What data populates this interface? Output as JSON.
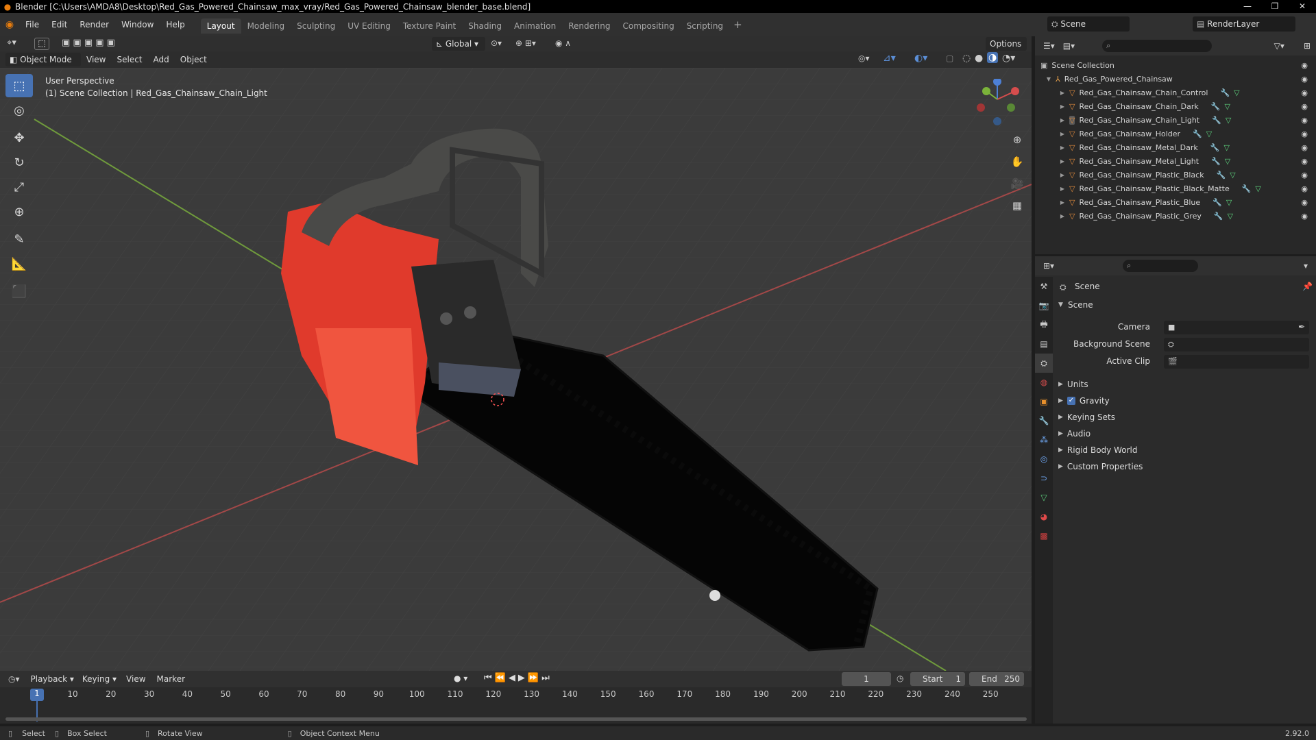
{
  "titlebar": {
    "title": "Blender [C:\\Users\\AMDA8\\Desktop\\Red_Gas_Powered_Chainsaw_max_vray/Red_Gas_Powered_Chainsaw_blender_base.blend]"
  },
  "menu": {
    "file": "File",
    "edit": "Edit",
    "render": "Render",
    "window": "Window",
    "help": "Help"
  },
  "workspaces": [
    {
      "label": "Layout",
      "active": true
    },
    {
      "label": "Modeling"
    },
    {
      "label": "Sculpting"
    },
    {
      "label": "UV Editing"
    },
    {
      "label": "Texture Paint"
    },
    {
      "label": "Shading"
    },
    {
      "label": "Animation"
    },
    {
      "label": "Rendering"
    },
    {
      "label": "Compositing"
    },
    {
      "label": "Scripting"
    }
  ],
  "add_workspace": "+",
  "scene_selector": "Scene",
  "renderlayer_selector": "RenderLayer",
  "viewport_header": {
    "transform_orientation": "Global",
    "options": "Options",
    "mode": "Object Mode",
    "view": "View",
    "select": "Select",
    "add": "Add",
    "object": "Object"
  },
  "viewport_info": {
    "perspective": "User Perspective",
    "collection": "(1) Scene Collection | Red_Gas_Chainsaw_Chain_Light"
  },
  "gizmo": {
    "x": "X",
    "y": "Y",
    "z": "Z"
  },
  "outliner": {
    "root": "Scene Collection",
    "collection": "Red_Gas_Powered_Chainsaw",
    "objects": [
      "Red_Gas_Chainsaw_Chain_Control",
      "Red_Gas_Chainsaw_Chain_Dark",
      "Red_Gas_Chainsaw_Chain_Light",
      "Red_Gas_Chainsaw_Holder",
      "Red_Gas_Chainsaw_Metal_Dark",
      "Red_Gas_Chainsaw_Metal_Light",
      "Red_Gas_Chainsaw_Plastic_Black",
      "Red_Gas_Chainsaw_Plastic_Black_Matte",
      "Red_Gas_Chainsaw_Plastic_Blue",
      "Red_Gas_Chainsaw_Plastic_Grey"
    ]
  },
  "properties": {
    "context": "Scene",
    "panel_scene": "Scene",
    "camera_label": "Camera",
    "background_label": "Background Scene",
    "clip_label": "Active Clip",
    "sections": [
      "Units",
      "Gravity",
      "Keying Sets",
      "Audio",
      "Rigid Body World",
      "Custom Properties"
    ],
    "gravity_checked": true
  },
  "timeline": {
    "playback": "Playback",
    "keying": "Keying",
    "view": "View",
    "marker": "Marker",
    "current_frame": "1",
    "start_label": "Start",
    "start_value": "1",
    "end_label": "End",
    "end_value": "250",
    "playhead": "1",
    "ticks": [
      "10",
      "20",
      "30",
      "40",
      "50",
      "60",
      "70",
      "80",
      "90",
      "100",
      "110",
      "120",
      "130",
      "140",
      "150",
      "160",
      "170",
      "180",
      "190",
      "200",
      "210",
      "220",
      "230",
      "240",
      "250"
    ]
  },
  "statusbar": {
    "select": "Select",
    "box_select": "Box Select",
    "rotate": "Rotate View",
    "context_menu": "Object Context Menu",
    "version": "2.92.0"
  },
  "colors": {
    "accent": "#4772b3",
    "object_orange": "#e08a3c",
    "chainsaw_red": "#e03a2c"
  }
}
